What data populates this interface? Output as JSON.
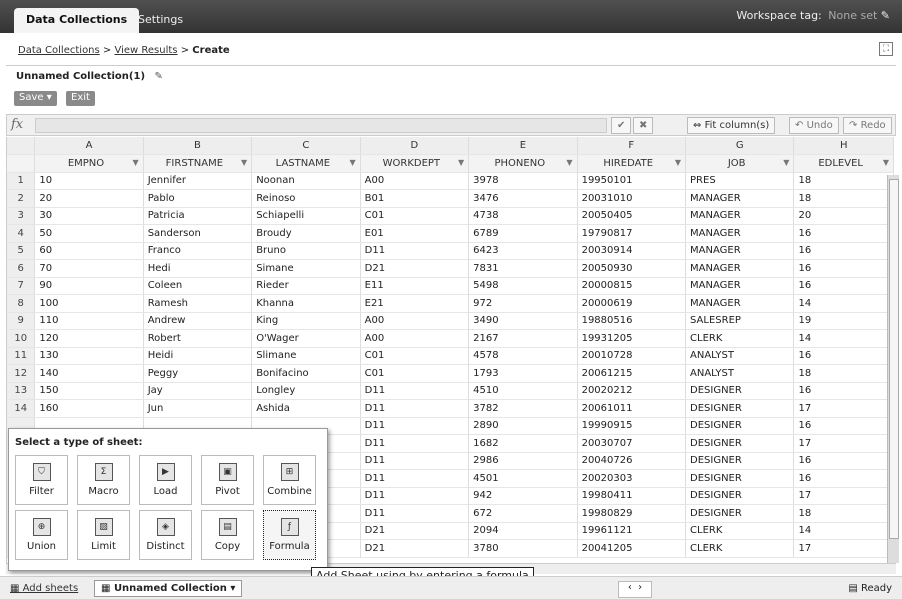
{
  "tabs": [
    "Data Collections",
    "Settings"
  ],
  "workspace": {
    "label": "Workspace tag:",
    "value": "None set"
  },
  "breadcrumb": {
    "items": [
      "Data Collections",
      "View Results"
    ],
    "current": "Create",
    "sep": ">"
  },
  "collection": {
    "name": "Unnamed Collection(1)"
  },
  "toolbar": {
    "save_label": "Save ▾",
    "exit_label": "Exit"
  },
  "formula_bar": {
    "fx": "fx",
    "fit_label": "Fit column(s)",
    "undo_label": "Undo",
    "redo_label": "Redo"
  },
  "grid": {
    "col_letters": [
      "A",
      "B",
      "C",
      "D",
      "E",
      "F",
      "G",
      "H"
    ],
    "fields": [
      "EMPNO",
      "FIRSTNAME",
      "LASTNAME",
      "WORKDEPT",
      "PHONENO",
      "HIREDATE",
      "JOB",
      "EDLEVEL"
    ],
    "rows": [
      [
        "1",
        "10",
        "Jennifer",
        "Noonan",
        "A00",
        "3978",
        "19950101",
        "PRES",
        "18"
      ],
      [
        "2",
        "20",
        "Pablo",
        "Reinoso",
        "B01",
        "3476",
        "20031010",
        "MANAGER",
        "18"
      ],
      [
        "3",
        "30",
        "Patricia",
        "Schiapelli",
        "C01",
        "4738",
        "20050405",
        "MANAGER",
        "20"
      ],
      [
        "4",
        "50",
        "Sanderson",
        "Broudy",
        "E01",
        "6789",
        "19790817",
        "MANAGER",
        "16"
      ],
      [
        "5",
        "60",
        "Franco",
        "Bruno",
        "D11",
        "6423",
        "20030914",
        "MANAGER",
        "16"
      ],
      [
        "6",
        "70",
        "Hedi",
        "Simane",
        "D21",
        "7831",
        "20050930",
        "MANAGER",
        "16"
      ],
      [
        "7",
        "90",
        "Coleen",
        "Rieder",
        "E11",
        "5498",
        "20000815",
        "MANAGER",
        "16"
      ],
      [
        "8",
        "100",
        "Ramesh",
        "Khanna",
        "E21",
        "972",
        "20000619",
        "MANAGER",
        "14"
      ],
      [
        "9",
        "110",
        "Andrew",
        "King",
        "A00",
        "3490",
        "19880516",
        "SALESREP",
        "19"
      ],
      [
        "10",
        "120",
        "Robert",
        "O'Wager",
        "A00",
        "2167",
        "19931205",
        "CLERK",
        "14"
      ],
      [
        "11",
        "130",
        "Heidi",
        "Slimane",
        "C01",
        "4578",
        "20010728",
        "ANALYST",
        "16"
      ],
      [
        "12",
        "140",
        "Peggy",
        "Bonifacino",
        "C01",
        "1793",
        "20061215",
        "ANALYST",
        "18"
      ],
      [
        "13",
        "150",
        "Jay",
        "Longley",
        "D11",
        "4510",
        "20020212",
        "DESIGNER",
        "16"
      ],
      [
        "14",
        "160",
        "Jun",
        "Ashida",
        "D11",
        "3782",
        "20061011",
        "DESIGNER",
        "17"
      ],
      [
        "",
        "",
        "",
        "",
        "D11",
        "2890",
        "19990915",
        "DESIGNER",
        "16"
      ],
      [
        "",
        "",
        "",
        "",
        "D11",
        "1682",
        "20030707",
        "DESIGNER",
        "17"
      ],
      [
        "",
        "",
        "",
        "",
        "D11",
        "2986",
        "20040726",
        "DESIGNER",
        "16"
      ],
      [
        "",
        "",
        "",
        "",
        "D11",
        "4501",
        "20020303",
        "DESIGNER",
        "16"
      ],
      [
        "",
        "",
        "",
        "",
        "D11",
        "942",
        "19980411",
        "DESIGNER",
        "17"
      ],
      [
        "",
        "",
        "",
        "",
        "D11",
        "672",
        "19980829",
        "DESIGNER",
        "18"
      ],
      [
        "",
        "",
        "",
        "",
        "D21",
        "2094",
        "19961121",
        "CLERK",
        "14"
      ],
      [
        "",
        "",
        "",
        "",
        "D21",
        "3780",
        "20041205",
        "CLERK",
        "17"
      ]
    ]
  },
  "popup": {
    "title": "Select a type of sheet:",
    "tiles": [
      "Filter",
      "Macro",
      "Load",
      "Pivot",
      "Combine",
      "Union",
      "Limit",
      "Distinct",
      "Copy",
      "Formula"
    ]
  },
  "tooltip": "Add Sheet using by entering a formula",
  "bottom": {
    "add_sheets": "Add sheets",
    "sheet_tab": "Unnamed Collection ▾",
    "status": "Ready"
  }
}
